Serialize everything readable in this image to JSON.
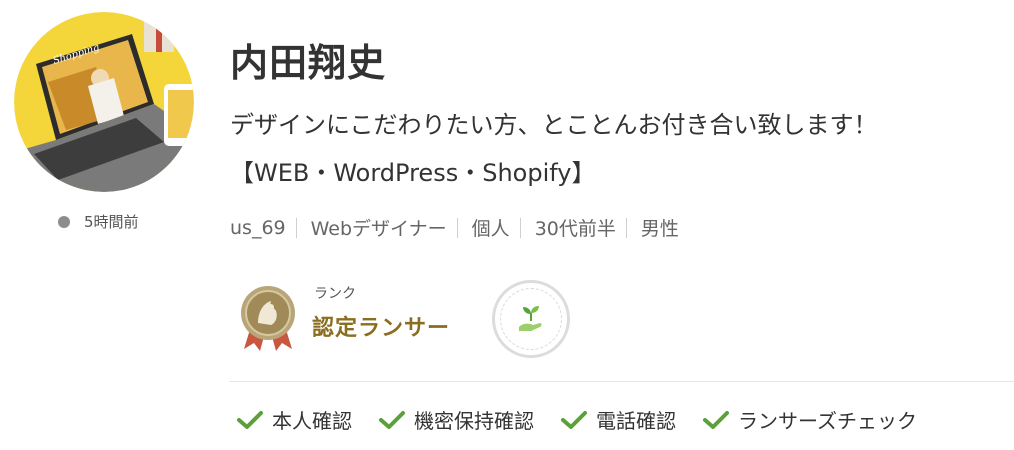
{
  "profile": {
    "name": "内田翔史",
    "catchphrase_line1": "デザインにこだわりたい方、とことんお付き合い致します！",
    "catchphrase_line2": "【WEB・WordPress・Shopify】",
    "last_login": "5時間前",
    "meta": [
      "us_69",
      "Webデザイナー",
      "個人",
      "30代前半",
      "男性"
    ]
  },
  "avatar": {
    "screen_title": "Shopping"
  },
  "rank": {
    "caption": "ランク",
    "name": "認定ランサー"
  },
  "verifications": [
    {
      "label": "本人確認"
    },
    {
      "label": "機密保持確認"
    },
    {
      "label": "電話確認"
    },
    {
      "label": "ランサーズチェック"
    }
  ],
  "colors": {
    "rank_text": "#8a6d1f",
    "check_green": "#5aa13a",
    "status_dot": "#8c8c8c",
    "avatar_bg": "#f5d63a"
  },
  "icons": {
    "status": "online-status-dot",
    "medal": "certified-medal-icon",
    "badge": "sprout-hand-icon",
    "check": "check-icon"
  }
}
